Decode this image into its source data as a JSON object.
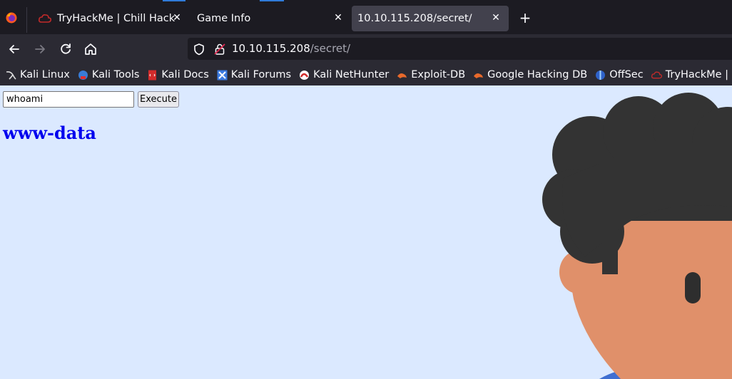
{
  "browser": {
    "tabs": [
      {
        "title": "TryHackMe | Chill Hack",
        "icon": "thm-cloud-icon",
        "active": false
      },
      {
        "title": "Game Info",
        "icon": "",
        "active": false
      },
      {
        "title": "10.10.115.208/secret/",
        "icon": "",
        "active": true
      }
    ],
    "url": {
      "host": "10.10.115.208",
      "path": "/secret/"
    },
    "bookmarks": [
      {
        "label": "Kali Linux",
        "icon": "kali-dragon-icon"
      },
      {
        "label": "Kali Tools",
        "icon": "kali-tools-icon"
      },
      {
        "label": "Kali Docs",
        "icon": "kali-docs-icon"
      },
      {
        "label": "Kali Forums",
        "icon": "kali-forums-icon"
      },
      {
        "label": "Kali NetHunter",
        "icon": "nethunter-icon"
      },
      {
        "label": "Exploit-DB",
        "icon": "exploit-db-icon"
      },
      {
        "label": "Google Hacking DB",
        "icon": "ghdb-icon"
      },
      {
        "label": "OffSec",
        "icon": "offsec-icon"
      },
      {
        "label": "TryHackMe | Ice",
        "icon": "thm-cloud-icon"
      }
    ]
  },
  "page": {
    "command_input_value": "whoami",
    "execute_label": "Execute",
    "output": "www-data"
  },
  "colors": {
    "page_bg": "#dbe9ff",
    "link_blue": "#0000ee",
    "hair": "#333333",
    "skin": "#e0906a"
  }
}
